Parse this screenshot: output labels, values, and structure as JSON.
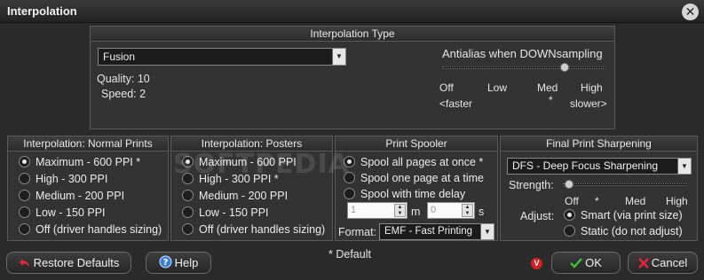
{
  "window": {
    "title": "Interpolation",
    "close_glyph": "✕"
  },
  "interp_type": {
    "header": "Interpolation Type",
    "method_value": "Fusion",
    "quality_label": "Quality: 10",
    "speed_label": "Speed: 2",
    "antialias_label": "Antialias when DOWNsampling",
    "antialias_level_fraction": 0.75,
    "scale": {
      "off": "Off",
      "low": "Low",
      "med": "Med",
      "high": "High",
      "faster": "<faster",
      "star": "*",
      "slower": "slower>"
    }
  },
  "normal_prints": {
    "header": "Interpolation: Normal Prints",
    "options": [
      "Maximum - 600 PPI *",
      "High - 300 PPI",
      "Medium - 200 PPI",
      "Low - 150 PPI",
      "Off (driver handles sizing)"
    ],
    "selected_index": 0
  },
  "posters": {
    "header": "Interpolation: Posters",
    "options": [
      "Maximum - 600 PPI",
      "High - 300 PPI *",
      "Medium - 200 PPI",
      "Low - 150 PPI",
      "Off (driver handles sizing)"
    ],
    "selected_index": 0
  },
  "spooler": {
    "header": "Print Spooler",
    "options": [
      "Spool all pages at once *",
      "Spool one page at a time",
      "Spool with time delay"
    ],
    "selected_index": 0,
    "delay_minutes": "1",
    "minutes_unit": "m",
    "delay_seconds": "0",
    "seconds_unit": "s",
    "format_label": "Format:",
    "format_value": "EMF - Fast Printing"
  },
  "sharpening": {
    "header": "Final Print Sharpening",
    "method_value": "DFS - Deep Focus Sharpening",
    "strength_label": "Strength:",
    "strength_fraction": 0.05,
    "scale": {
      "off": "Off",
      "star": "*",
      "med": "Med",
      "high": "High"
    },
    "adjust_label": "Adjust:",
    "adjust_options": [
      "Smart (via print size)",
      "Static (do not adjust)"
    ],
    "adjust_selected_index": 0
  },
  "footer": {
    "default_note": "* Default",
    "restore_label": "Restore Defaults",
    "help_label": "Help",
    "ok_label": "OK",
    "cancel_label": "Cancel",
    "watermark": "SOFTPEDIA"
  }
}
